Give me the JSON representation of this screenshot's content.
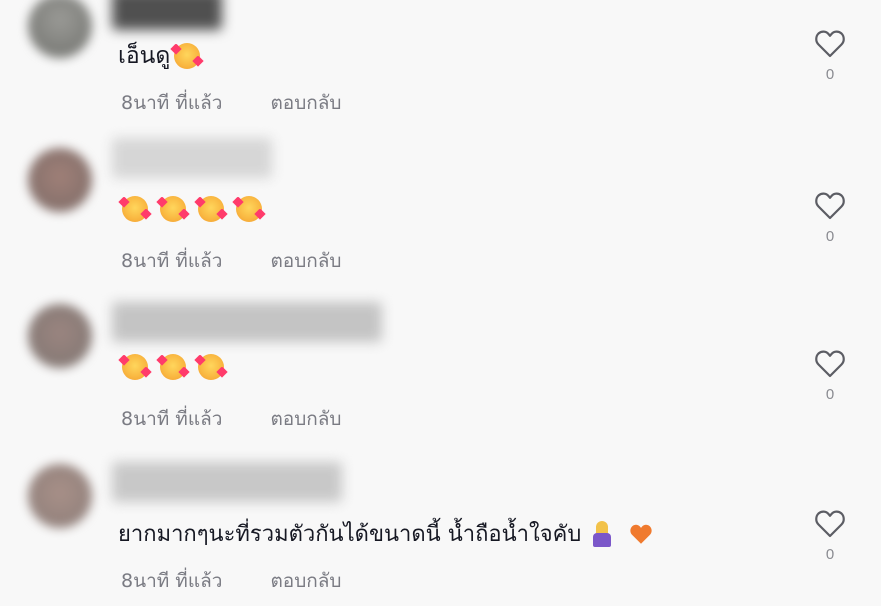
{
  "comments": [
    {
      "text": "เอ็นดู",
      "emoji_count": 1,
      "time": "8นาที ที่แล้ว",
      "reply_label": "ตอบกลับ",
      "likes": "0"
    },
    {
      "text": "",
      "emoji_count": 4,
      "time": "8นาที ที่แล้ว",
      "reply_label": "ตอบกลับ",
      "likes": "0"
    },
    {
      "text": "",
      "emoji_count": 3,
      "time": "8นาที ที่แล้ว",
      "reply_label": "ตอบกลับ",
      "likes": "0"
    },
    {
      "text": "ยากมากๆนะที่รวมตัวกันได้ขนาดนี้ น้ำถือน้ำใจคับ",
      "emoji_count": 0,
      "time": "8นาที ที่แล้ว",
      "reply_label": "ตอบกลับ",
      "likes": "0"
    }
  ],
  "icons": {
    "like": "heart-outline-icon",
    "smiling_hearts": "smiling-face-with-hearts-emoji",
    "pray": "folded-hands-emoji",
    "orange_heart": "orange-heart-emoji"
  },
  "colors": {
    "background": "#f8f8f8",
    "text": "#161823",
    "meta": "#7a7b83",
    "icon": "#5c5d64"
  }
}
